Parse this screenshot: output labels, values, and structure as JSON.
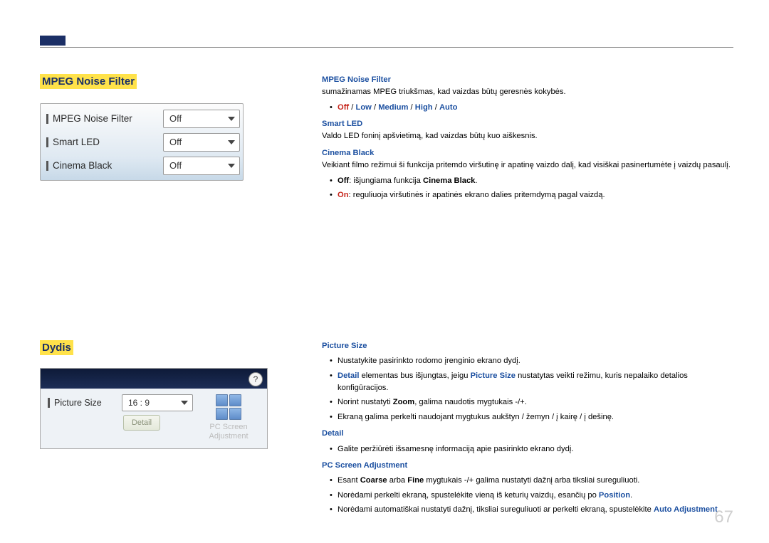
{
  "section_a": {
    "title": "MPEG Noise Filter",
    "panel": {
      "rows": [
        {
          "label": "MPEG Noise Filter",
          "value": "Off"
        },
        {
          "label": "Smart LED",
          "value": "Off"
        },
        {
          "label": "Cinema Black",
          "value": "Off"
        }
      ]
    },
    "desc": {
      "mpeg_title": "MPEG Noise Filter",
      "mpeg_text": "sumažinamas MPEG triukšmas, kad vaizdas būtų geresnės kokybės.",
      "mpeg_options_prefix": "Off",
      "mpeg_opt2": "Low",
      "mpeg_opt3": "Medium",
      "mpeg_opt4": "High",
      "mpeg_opt5": "Auto",
      "sep": " / ",
      "smart_title": "Smart LED",
      "smart_text": "Valdo LED foninį apšvietimą, kad vaizdas būtų kuo aiškesnis.",
      "cinema_title": "Cinema Black",
      "cinema_text": "Veikiant filmo režimui ši funkcija pritemdo viršutinę ir apatinę vaizdo dalį, kad visiškai pasinertumėte į vaizdų pasaulį.",
      "off_label": "Off",
      "off_rest": ": išjungiama funkcija ",
      "cinema_bold": "Cinema Black",
      "period": ".",
      "on_label": "On",
      "on_rest": ": reguliuoja viršutinės ir apatinės ekrano dalies pritemdymą pagal vaizdą."
    }
  },
  "section_b": {
    "title": "Dydis",
    "panel": {
      "help": "?",
      "picture_label": "Picture Size",
      "picture_value": "16 : 9",
      "detail_btn": "Detail",
      "pc_line1": "PC Screen",
      "pc_line2": "Adjustment"
    },
    "desc": {
      "ps_title": "Picture Size",
      "ps_b1": "Nustatykite pasirinkto rodomo įrenginio ekrano dydį.",
      "ps_b2_a": "Detail",
      "ps_b2_mid": " elementas bus išjungtas, jeigu ",
      "ps_b2_b": "Picture Size",
      "ps_b2_end": " nustatytas veikti režimu, kuris nepalaiko detalios konfigūracijos.",
      "ps_b3_pre": "Norint nustatyti ",
      "ps_b3_zoom": "Zoom",
      "ps_b3_post": ", galima naudotis mygtukais -/+.",
      "ps_b4": "Ekraną galima perkelti naudojant mygtukus aukštyn / žemyn / į kairę / į dešinę.",
      "detail_title": "Detail",
      "detail_b1": "Galite peržiūrėti išsamesnę informaciją apie pasirinkto ekrano dydį.",
      "pc_title": "PC Screen Adjustment",
      "pc_b1_pre": "Esant ",
      "pc_b1_a": "Coarse",
      "pc_b1_mid": " arba ",
      "pc_b1_b": "Fine",
      "pc_b1_post": " mygtukais -/+ galima nustatyti dažnį arba tiksliai sureguliuoti.",
      "pc_b2_pre": "Norėdami perkelti ekraną, spustelėkite vieną iš keturių vaizdų, esančių po ",
      "pc_b2_a": "Position",
      "pc_b2_post": ".",
      "pc_b3_pre": "Norėdami automatiškai nustatyti dažnį, tiksliai sureguliuoti ar perkelti ekraną, spustelėkite ",
      "pc_b3_a": "Auto Adjustment",
      "pc_b3_post": "."
    }
  },
  "page_number": "67"
}
